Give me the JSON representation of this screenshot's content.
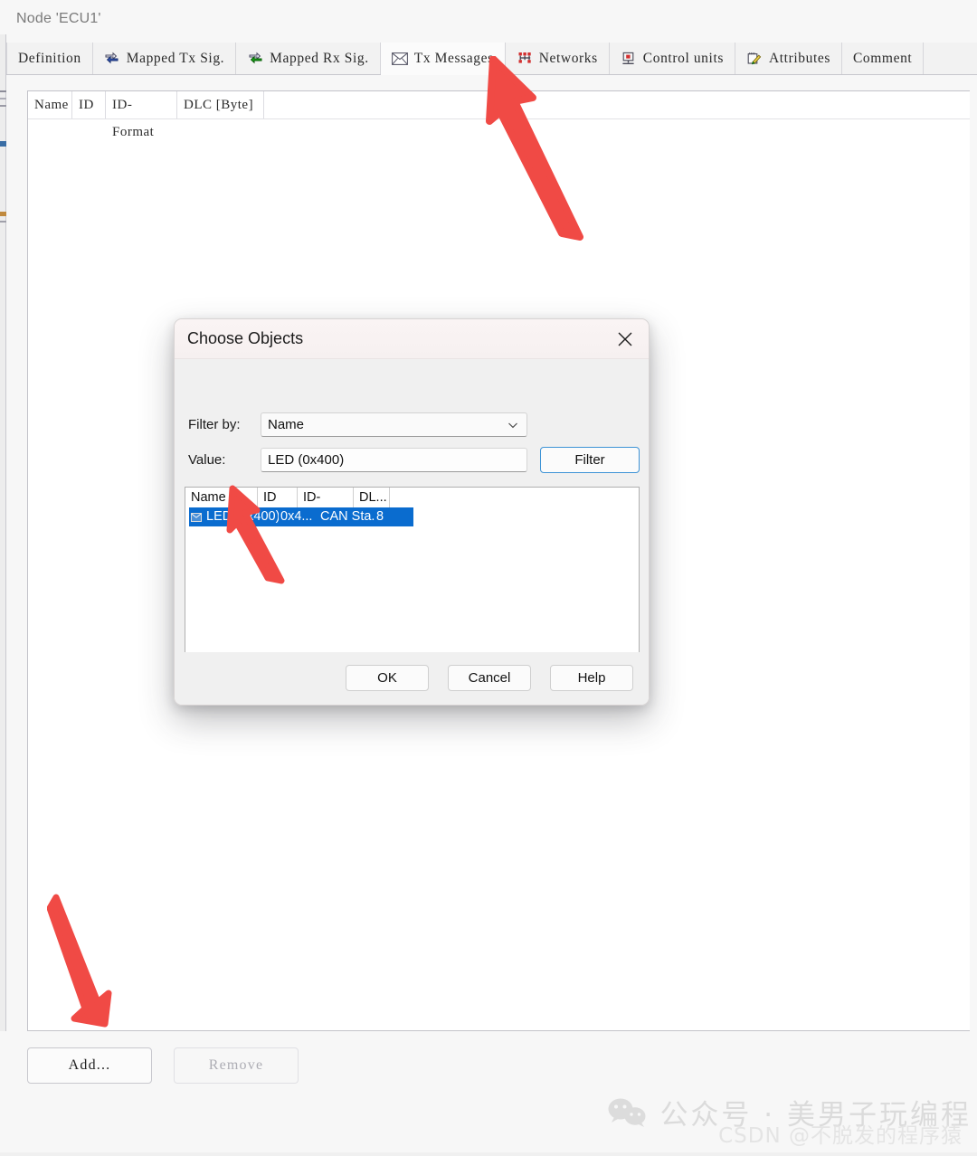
{
  "window": {
    "title": "Node 'ECU1'"
  },
  "tabs": [
    {
      "label": "Definition",
      "icon": "",
      "active": false
    },
    {
      "label": "Mapped Tx Sig.",
      "icon": "mapped-tx-sig-icon",
      "active": false
    },
    {
      "label": "Mapped Rx Sig.",
      "icon": "mapped-rx-sig-icon",
      "active": false
    },
    {
      "label": "Tx Messages",
      "icon": "envelope-icon",
      "active": true
    },
    {
      "label": "Networks",
      "icon": "network-icon",
      "active": false
    },
    {
      "label": "Control units",
      "icon": "control-unit-icon",
      "active": false
    },
    {
      "label": "Attributes",
      "icon": "attributes-pencil-icon",
      "active": false
    },
    {
      "label": "Comment",
      "icon": "",
      "active": false
    }
  ],
  "grid": {
    "columns": [
      "Name",
      "ID",
      "ID-Format",
      "DLC [Byte]"
    ],
    "rows": []
  },
  "toolbar": {
    "add_label": "Add...",
    "remove_label": "Remove",
    "remove_disabled": true
  },
  "dialog": {
    "title": "Choose Objects",
    "close_icon": "close-icon",
    "filter_by_label": "Filter by:",
    "filter_by_value": "Name",
    "value_label": "Value:",
    "value_text": "LED (0x400)",
    "filter_button": "Filter",
    "list": {
      "columns": [
        "Name",
        "ID",
        "ID-Format",
        "DL..."
      ],
      "rows": [
        {
          "icon": "message-icon",
          "name": "LED (0x400)",
          "id": "0x4...",
          "id_format": "CAN Sta...",
          "dlc": "8",
          "selected": true
        }
      ]
    },
    "buttons": [
      "OK",
      "Cancel",
      "Help"
    ]
  },
  "annotations": {
    "arrow_color": "#F04A45",
    "arrows": [
      {
        "name": "arrow-to-tx-messages-tab"
      },
      {
        "name": "arrow-to-selected-list-row"
      },
      {
        "name": "arrow-to-add-button"
      }
    ]
  },
  "watermark": {
    "main": "公众号 · 美男子玩编程",
    "sub": "CSDN @不脱发的程序猿",
    "logo": "wechat-icon"
  }
}
